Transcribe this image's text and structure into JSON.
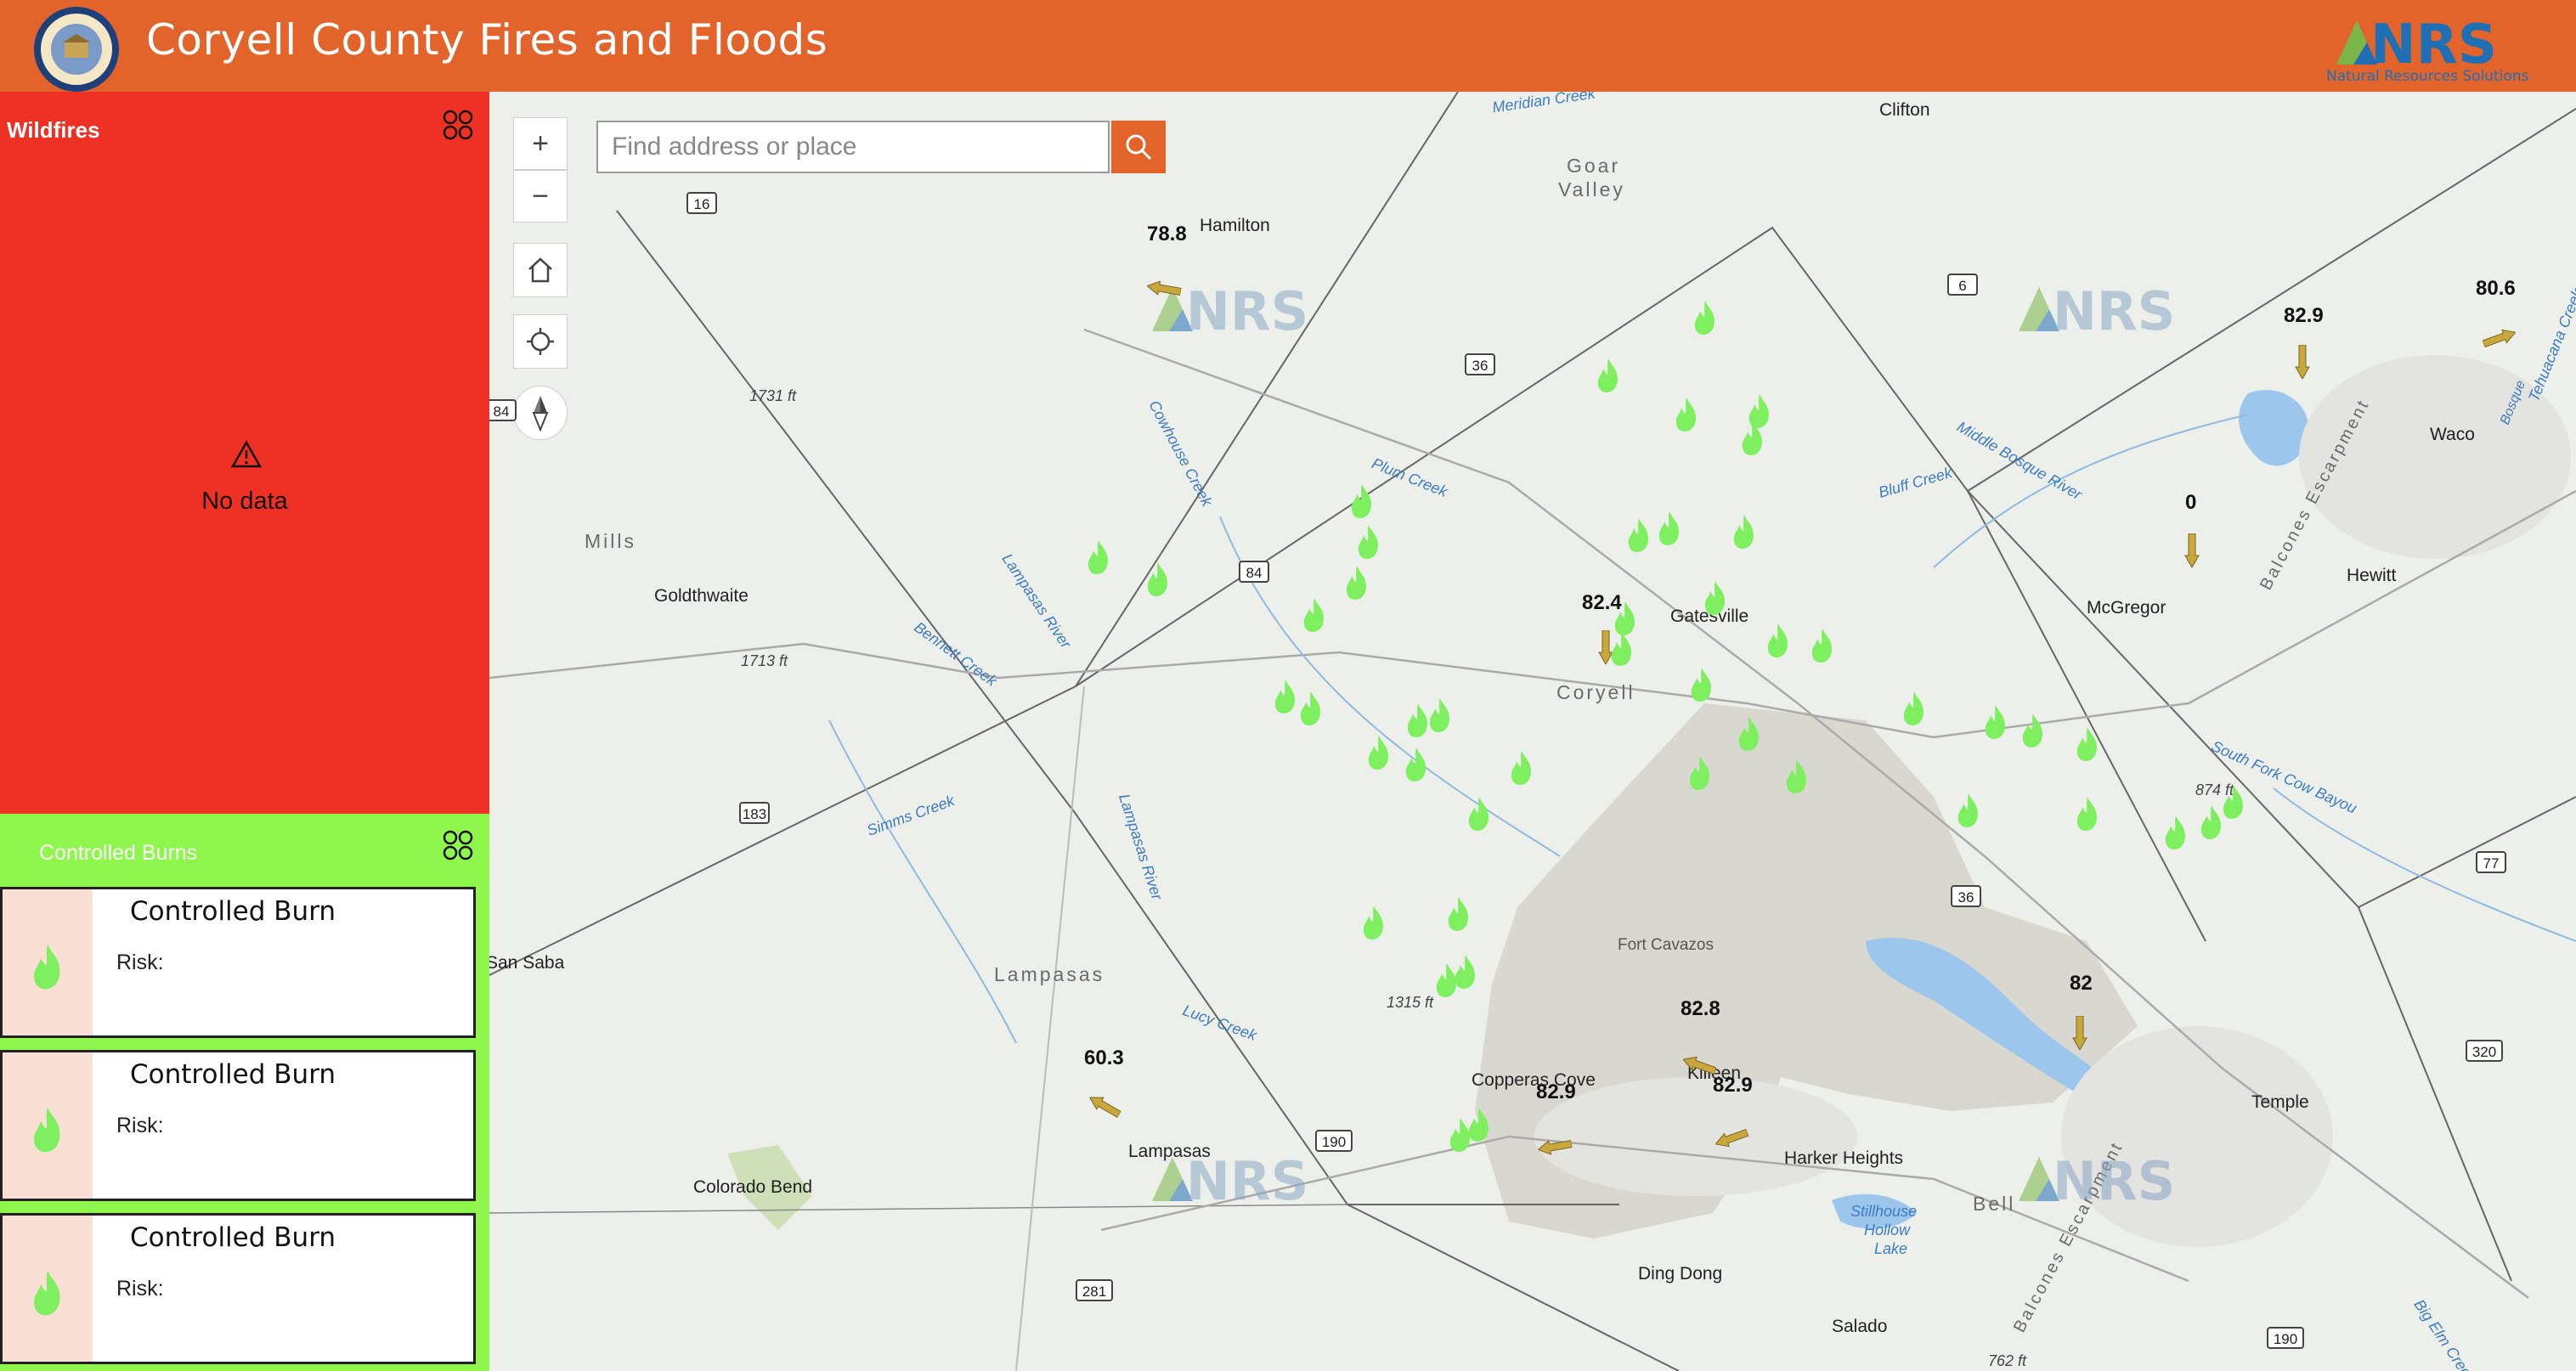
{
  "header": {
    "title": "Coryell County Fires and Floods",
    "seal_text": "CORYELL COUNTY TEXAS",
    "logo_text": "NRS",
    "logo_subtitle": "Natural Resources Solutions"
  },
  "colors": {
    "header": "#e2642b",
    "wildfires_panel": "#ee3124",
    "burns_panel": "#8ff64d",
    "fire_marker": "#7ef05f",
    "arrow_marker": "#c8a83c"
  },
  "wildfires": {
    "title": "Wildfires",
    "empty_message": "No data"
  },
  "controlled_burns": {
    "title": "Controlled Burns",
    "items": [
      {
        "title": "Controlled Burn",
        "risk_label": "Risk:"
      },
      {
        "title": "Controlled Burn",
        "risk_label": "Risk:"
      },
      {
        "title": "Controlled Burn",
        "risk_label": "Risk:"
      }
    ]
  },
  "map": {
    "search_placeholder": "Find address or place",
    "places": [
      "Clifton",
      "Hamilton",
      "Waco",
      "Hewitt",
      "McGregor",
      "Goldthwaite",
      "Gatesville",
      "Fort Cavazos",
      "Copperas Cove",
      "Killeen",
      "Harker Heights",
      "Temple",
      "Lampasas",
      "Colorado Bend",
      "Salado",
      "Ding Dong",
      "San Saba"
    ],
    "regions": [
      "Goar",
      "Valley",
      "Mills",
      "Coryell",
      "Lampasas",
      "Bell"
    ],
    "landmarks": [
      "Balcones Escarpment",
      "Balcones Escarpment"
    ],
    "elevations": [
      "1731 ft",
      "1713 ft",
      "874 ft",
      "1315 ft",
      "762 ft"
    ],
    "waters": [
      "Meridian Creek",
      "Cowhouse Creek",
      "Plum Creek",
      "Middle Bosque River",
      "Bluff Creek",
      "Lampasas River",
      "Bennett Creek",
      "Simms Creek",
      "Lampasas River",
      "Lucy Creek",
      "South Fork Cow Bayou",
      "Stillhouse",
      "Hollow",
      "Lake",
      "Big Elm Creek",
      "Tehuacana Creek",
      "Bosque"
    ],
    "routes": [
      "16",
      "6",
      "36",
      "84",
      "84",
      "183",
      "36",
      "77",
      "320",
      "190",
      "281",
      "190"
    ],
    "readings": [
      "78.8",
      "82.9",
      "80.6",
      "0",
      "82.4",
      "82.8",
      "82.9",
      "82.9",
      "60.3",
      "82"
    ]
  }
}
